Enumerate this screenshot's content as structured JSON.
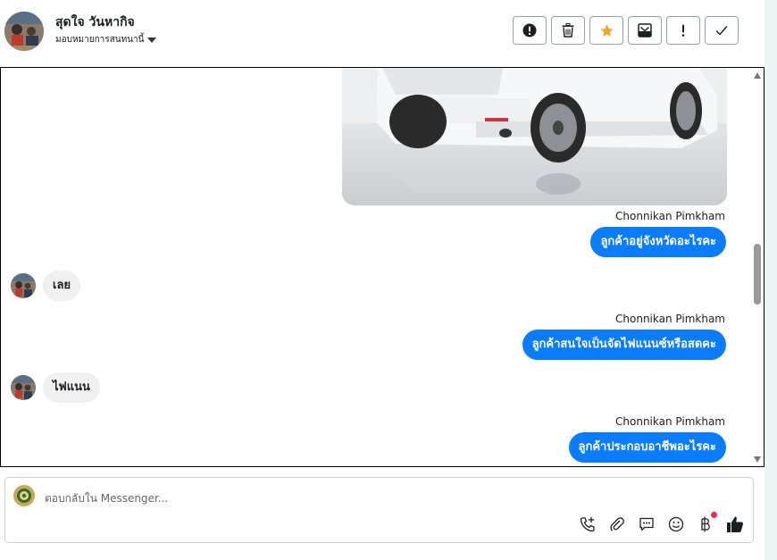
{
  "header": {
    "contact_name": "สุดใจ วันหากิจ",
    "assign_label": "มอบหมายการสนทนานี้",
    "actions": [
      {
        "icon": "exclamation-circle-icon",
        "label": "mark-spam"
      },
      {
        "icon": "trash-icon",
        "label": "delete"
      },
      {
        "icon": "star-icon",
        "label": "star"
      },
      {
        "icon": "envelope-icon",
        "label": "mark-unread"
      },
      {
        "icon": "exclamation-icon",
        "label": "follow-up"
      },
      {
        "icon": "check-icon",
        "label": "mark-done"
      }
    ],
    "star_color": "#f5a623"
  },
  "chat": {
    "messages": [
      {
        "type": "image",
        "icon": "car-photo"
      },
      {
        "type": "out",
        "sender": "Chonnikan Pimkham",
        "text": "ลูกค้าอยู่จังหวัดอะไรคะ"
      },
      {
        "type": "in",
        "text": "เลย"
      },
      {
        "type": "out",
        "sender": "Chonnikan Pimkham",
        "text": "ลูกค้าสนใจเป็นจัดไฟแนนซ์หรือสดคะ"
      },
      {
        "type": "in",
        "text": "ไฟแนน"
      },
      {
        "type": "out",
        "sender": "Chonnikan Pimkham",
        "text": "ลูกค้าประกอบอาชีพอะไรคะ"
      }
    ],
    "outgoing_color": "#0a7cff"
  },
  "composer": {
    "placeholder": "ตอบกลับใน Messenger...",
    "tools": [
      "phone-add-icon",
      "paperclip-icon",
      "saved-reply-icon",
      "emoji-icon",
      "baht-icon",
      "thumbs-up-icon"
    ]
  }
}
